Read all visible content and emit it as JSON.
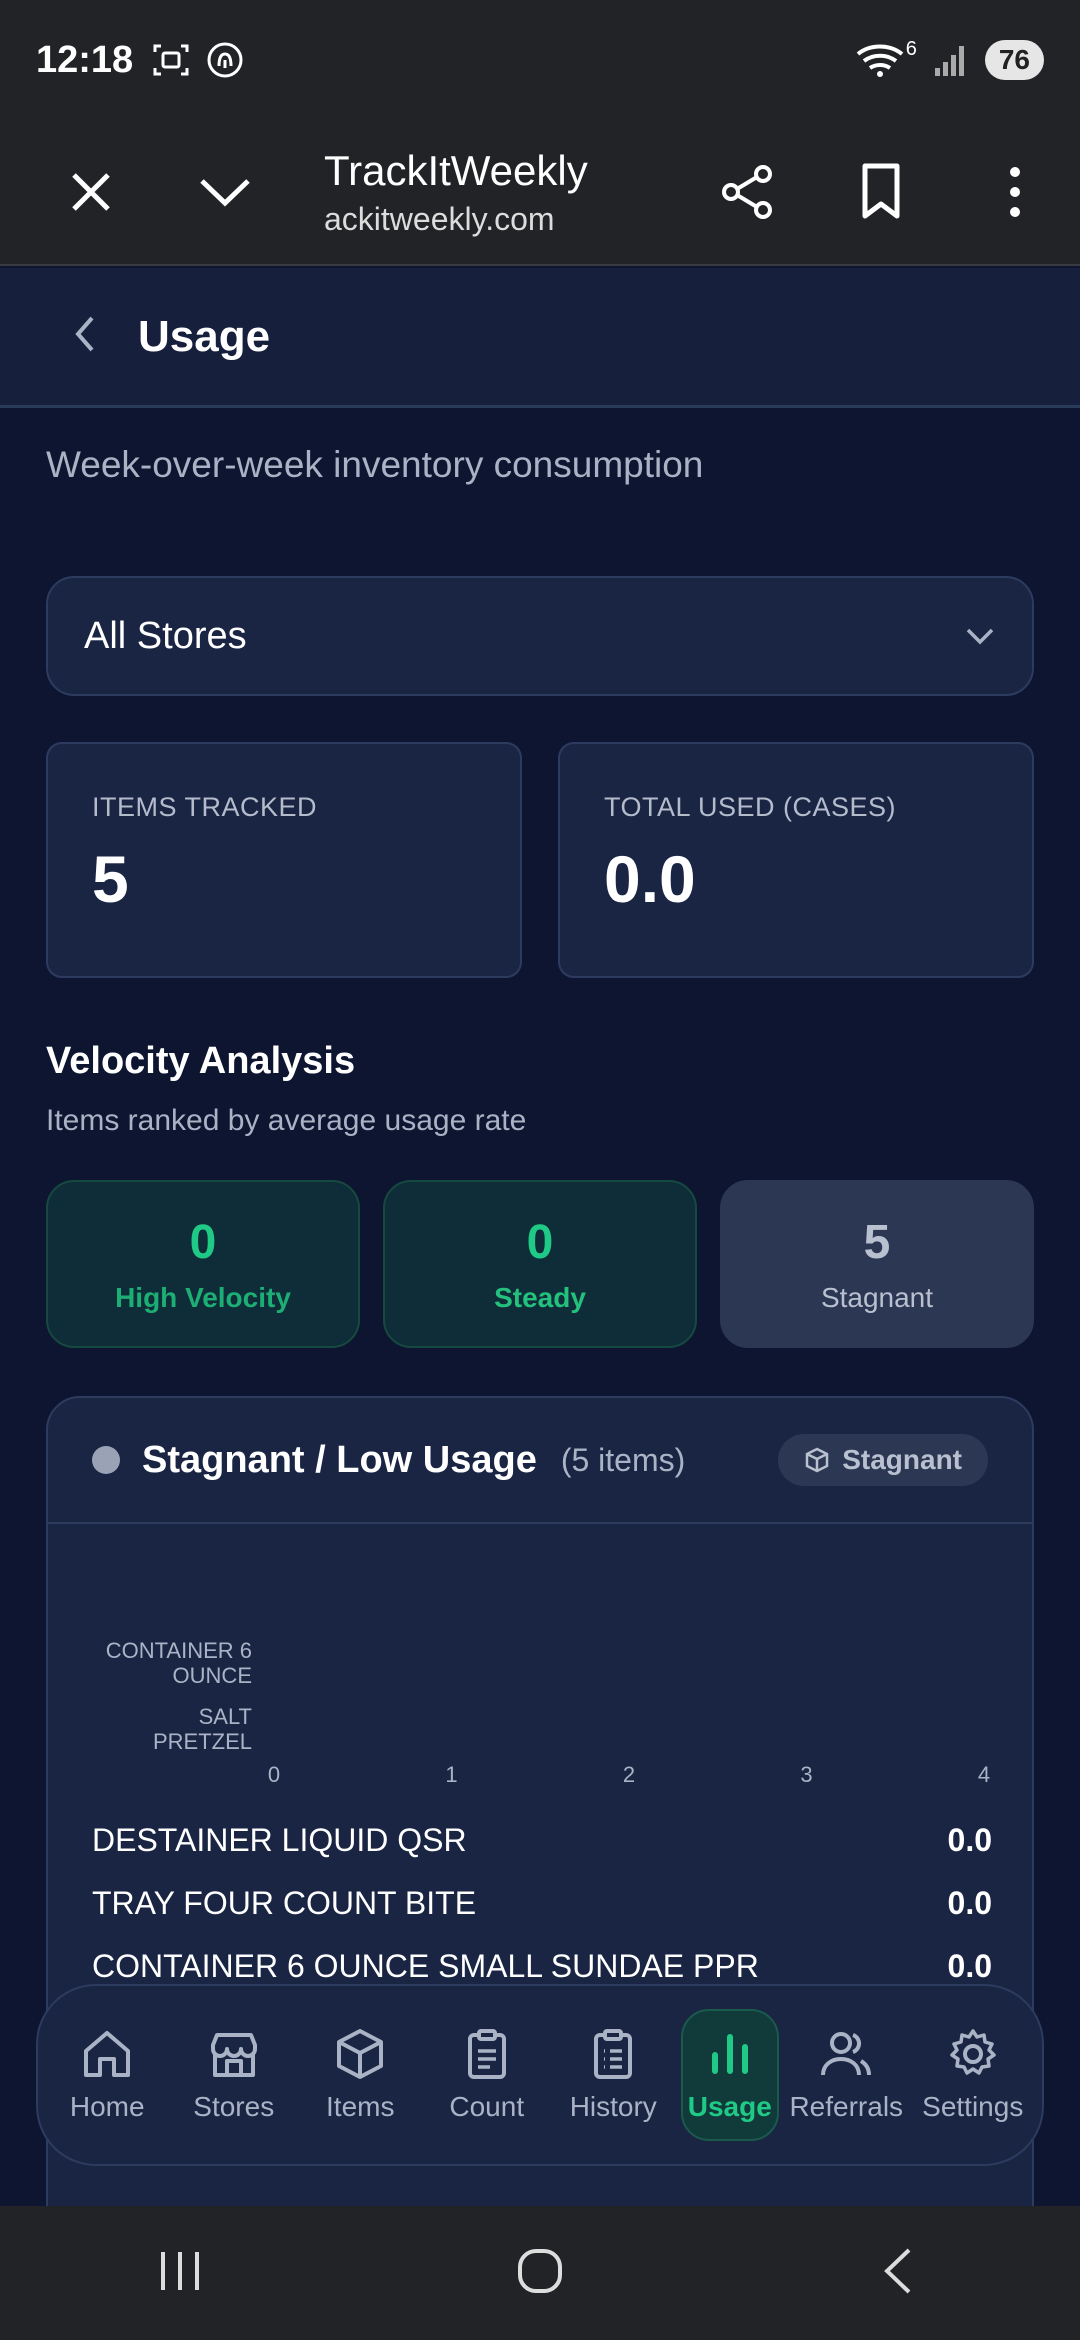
{
  "status": {
    "time": "12:18",
    "battery": "76",
    "signal_label": "6"
  },
  "browser": {
    "title": "TrackItWeekly",
    "url": "ackitweekly.com"
  },
  "header": {
    "title": "Usage"
  },
  "page": {
    "subtitle": "Week-over-week inventory consumption"
  },
  "store_select": {
    "value": "All Stores"
  },
  "stats": [
    {
      "label": "ITEMS TRACKED",
      "value": "5"
    },
    {
      "label": "TOTAL USED (CASES)",
      "value": "0.0"
    }
  ],
  "velocity": {
    "title": "Velocity Analysis",
    "subtitle": "Items ranked by average usage rate",
    "tiles": [
      {
        "count": "0",
        "label": "High Velocity"
      },
      {
        "count": "0",
        "label": "Steady"
      },
      {
        "count": "5",
        "label": "Stagnant"
      }
    ]
  },
  "stagnant_panel": {
    "title": "Stagnant / Low Usage",
    "count": "(5 items)",
    "badge": "Stagnant"
  },
  "chart_data": {
    "type": "bar",
    "orientation": "horizontal",
    "categories": [
      "CONTAINER 6 OUNCE",
      "SALT PRETZEL"
    ],
    "category_lines": [
      [
        "CONTAINER 6",
        "OUNCE"
      ],
      [
        "SALT",
        "PRETZEL"
      ]
    ],
    "values": [
      0,
      0
    ],
    "xlim": [
      0,
      4
    ],
    "xticks": [
      "0",
      "1",
      "2",
      "3",
      "4"
    ],
    "grid": false
  },
  "items": [
    {
      "name": "DESTAINER LIQUID QSR",
      "value": "0.0"
    },
    {
      "name": "TRAY FOUR COUNT BITE",
      "value": "0.0"
    },
    {
      "name": "CONTAINER 6 OUNCE SMALL SUNDAE PPR",
      "value": "0.0"
    }
  ],
  "nav": [
    {
      "label": "Home",
      "icon": "home-icon"
    },
    {
      "label": "Stores",
      "icon": "store-icon"
    },
    {
      "label": "Items",
      "icon": "box-icon"
    },
    {
      "label": "Count",
      "icon": "clipboard-icon"
    },
    {
      "label": "History",
      "icon": "clipboard-list-icon"
    },
    {
      "label": "Usage",
      "icon": "bar-chart-icon",
      "active": true
    },
    {
      "label": "Referrals",
      "icon": "users-icon"
    },
    {
      "label": "Settings",
      "icon": "gear-icon"
    }
  ],
  "colors": {
    "accent": "#1fca86",
    "background": "#0d1530",
    "card": "#1a2544"
  }
}
